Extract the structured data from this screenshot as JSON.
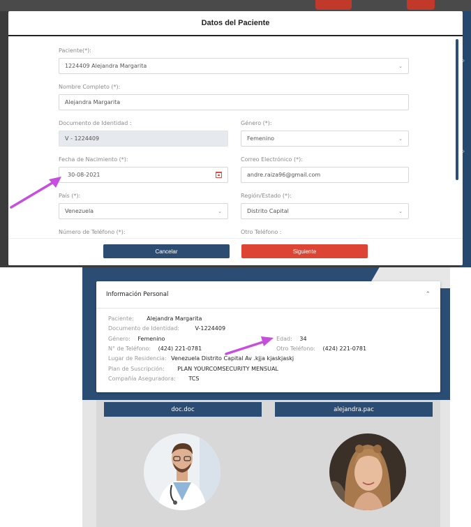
{
  "modal": {
    "title": "Datos del Paciente",
    "fields": {
      "paciente": {
        "label": "Paciente(*):",
        "value": "1224409 Alejandra Margarita"
      },
      "nombre": {
        "label": "Nombre Completo (*):",
        "value": "Alejandra Margarita"
      },
      "documento": {
        "label": "Documento de Identidad :",
        "value": "V - 1224409"
      },
      "genero": {
        "label": "Género (*):",
        "value": "Femenino"
      },
      "fecha": {
        "label": "Fecha de Nacimiento (*):",
        "value": "30-08-2021"
      },
      "correo": {
        "label": "Correo Electrónico (*):",
        "value": "andre.raiza96@gmail.com"
      },
      "pais": {
        "label": "País (*):",
        "value": "Venezuela"
      },
      "region": {
        "label": "Región/Estado (*):",
        "value": "Distrito Capital"
      },
      "telefono": {
        "label": "Número de Teléfono (*):"
      },
      "otro_telefono": {
        "label": "Otro Teléfono :"
      }
    },
    "buttons": {
      "cancel": "Cancelar",
      "next": "Siguiente"
    }
  },
  "profile": {
    "card_title": "Información Personal",
    "rows": {
      "paciente": {
        "label": "Paciente:",
        "value": "Alejandra Margarita"
      },
      "documento": {
        "label": "Documento de Identidad:",
        "value": "V-1224409"
      },
      "genero": {
        "label": "Género:",
        "value": "Femenino"
      },
      "edad": {
        "label": "Edad:",
        "value": "34"
      },
      "telefono": {
        "label": "N° de Teléfono:",
        "value": "(424) 221-0781"
      },
      "otro_telefono": {
        "label": "Otro Teléfono:",
        "value": "(424) 221-0781"
      },
      "residencia": {
        "label": "Lugar de Residencia:",
        "value": "Venezuela Distrito Capital Av .kjja kjaskjaskj"
      },
      "plan": {
        "label": "Plan de Suscripción:",
        "value": "PLAN YOURCOMSECURITY MENSUAL"
      },
      "aseguradora": {
        "label": "Compañía Aseguradora:",
        "value": "TCS"
      }
    },
    "doctor_name": "doc.doc",
    "patient_name": "alejandra.pac"
  },
  "colors": {
    "navy": "#2c4c72",
    "red": "#de4434",
    "annotation_arrow": "#c84ce0"
  }
}
